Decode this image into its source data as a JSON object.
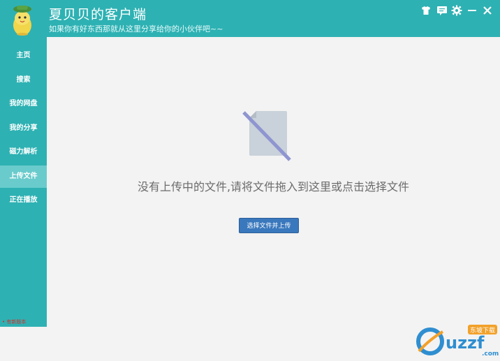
{
  "app": {
    "title": "夏贝贝的客户端",
    "subtitle": "如果你有好东西那就从这里分享给你的小伙伴吧~~"
  },
  "window_controls": [
    {
      "name": "skin-icon"
    },
    {
      "name": "message-icon"
    },
    {
      "name": "settings-icon"
    },
    {
      "name": "minimize-icon"
    },
    {
      "name": "close-icon"
    }
  ],
  "sidebar": {
    "items": [
      {
        "label": "主页"
      },
      {
        "label": "搜索"
      },
      {
        "label": "我的网盘"
      },
      {
        "label": "我的分享"
      },
      {
        "label": "磁力解析"
      },
      {
        "label": "上传文件",
        "active": true
      },
      {
        "label": "正在播放"
      }
    ],
    "footer_text": "有新版本"
  },
  "main": {
    "empty_message": "没有上传中的文件,请将文件拖入到这里或点击选择文件",
    "select_button": "选择文件并上传"
  },
  "watermark": {
    "brand": "uzzf",
    "suffix": ".com",
    "badge": "东坡下载"
  },
  "colors": {
    "header": "#2eb1b3",
    "sidebar_active": "#6acbcc",
    "button": "#3a78bd"
  }
}
